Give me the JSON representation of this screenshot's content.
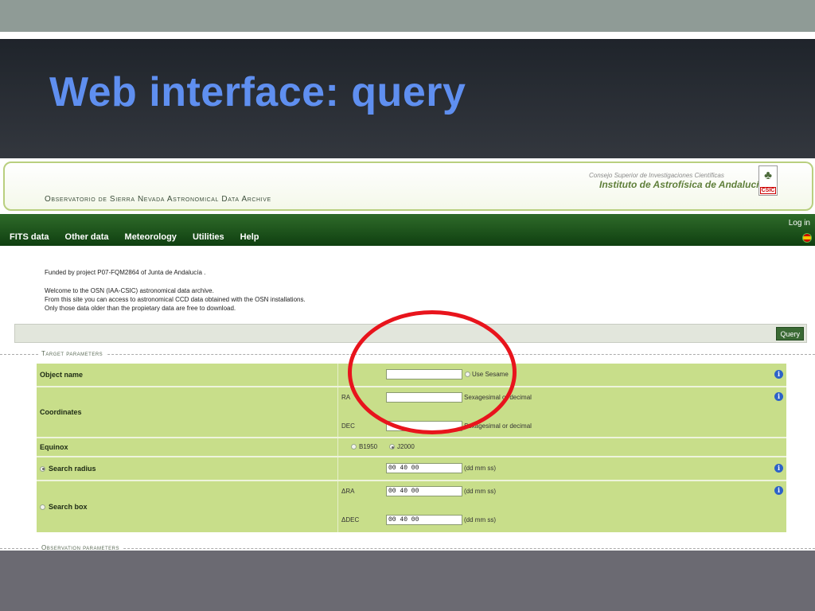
{
  "slide": {
    "title": "Web interface: query"
  },
  "banner": {
    "archive_title": "Observatorio de Sierra Nevada Astronomical Data Archive",
    "csic_small": "Consejo Superior de Investigaciones Científicas",
    "csic_institute": "Instituto de Astrofísica de Andalucía",
    "csic_logo_text": "CSIC"
  },
  "nav": {
    "items": [
      {
        "label": "FITS data"
      },
      {
        "label": "Other data"
      },
      {
        "label": "Meteorology"
      },
      {
        "label": "Utilities"
      },
      {
        "label": "Help"
      }
    ],
    "login": "Log in"
  },
  "intro": {
    "funded": "Funded by project P07-FQM2864 of Junta de Andalucía .",
    "welcome": "Welcome to the OSN (IAA-CSIC) astronomical data archive.",
    "access": "From this site you can access to astronomical CCD data obtained with the OSN installations.",
    "only": "Only those data older than the propietary data are free to download."
  },
  "query_button": "Query",
  "target_legend": "Target parameters",
  "observation_legend": "Observation parameters",
  "params": {
    "object_name": {
      "label": "Object name",
      "value": "",
      "sesame_label": "Use Sesame"
    },
    "coordinates": {
      "label": "Coordinates",
      "ra_label": "RA",
      "ra_value": "",
      "ra_hint": "Sexagesimal or decimal",
      "dec_label": "DEC",
      "dec_value": "",
      "dec_hint": "Sexagesimal or decimal"
    },
    "equinox": {
      "label": "Equinox",
      "opt1": "B1950",
      "opt2": "J2000"
    },
    "search_radius": {
      "label": "Search radius",
      "value": "00 40 00",
      "unit": "(dd mm ss)"
    },
    "search_box": {
      "label": "Search box",
      "dra_label": "ΔRA",
      "dra_value": "00 40 00",
      "dra_unit": "(dd mm ss)",
      "ddec_label": "ΔDEC",
      "ddec_value": "00 40 00",
      "ddec_unit": "(dd mm ss)"
    }
  },
  "colors": {
    "title_blue": "#5f8ff0",
    "nav_green": "#1e5a1c",
    "row_green": "#c8de8a",
    "annotation_red": "#e8141c"
  }
}
